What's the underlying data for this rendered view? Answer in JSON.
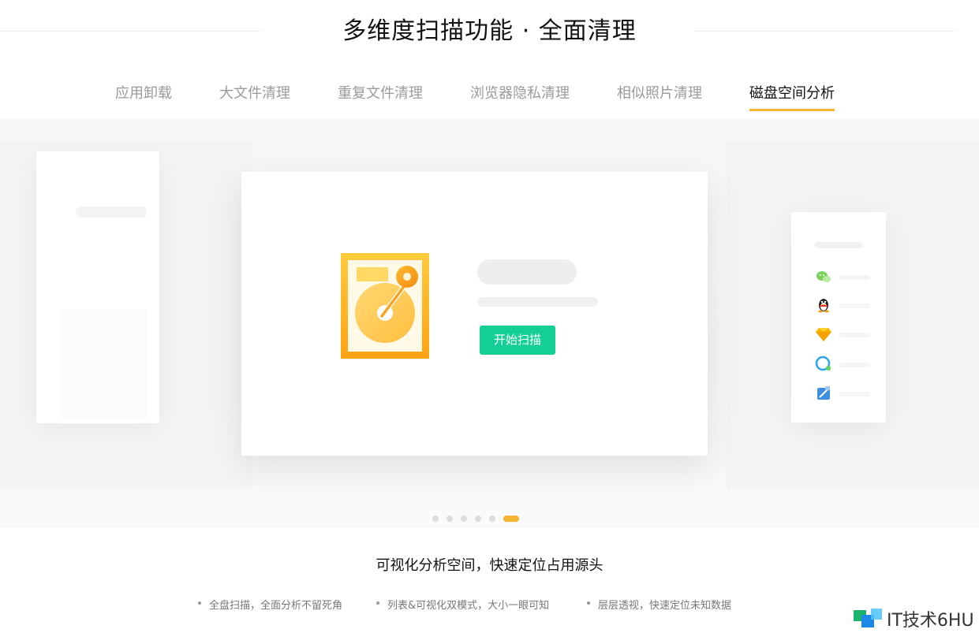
{
  "header": {
    "title": "多维度扫描功能 · 全面清理"
  },
  "tabs": [
    {
      "label": "应用卸载",
      "active": false
    },
    {
      "label": "大文件清理",
      "active": false
    },
    {
      "label": "重复文件清理",
      "active": false
    },
    {
      "label": "浏览器隐私清理",
      "active": false
    },
    {
      "label": "相似照片清理",
      "active": false
    },
    {
      "label": "磁盘空间分析",
      "active": true
    }
  ],
  "main_card": {
    "icon": "hard-disk-scan-icon",
    "scan_button_label": "开始扫描"
  },
  "side_card_right": {
    "app_icons": [
      "wechat-icon",
      "qq-penguin-icon",
      "sketch-diamond-icon",
      "chat-bubble-icon",
      "xcode-icon"
    ]
  },
  "pagination": {
    "count": 6,
    "active_index": 5
  },
  "caption": "可视化分析空间，快速定位占用源头",
  "features": [
    "全盘扫描，全面分析不留死角",
    "列表&可视化双模式，大小一眼可知",
    "层层透视，快速定位未知数据"
  ],
  "watermark": {
    "text": "IT技术6HU",
    "icon": "watermark-logo-icon"
  },
  "colors": {
    "accent": "#f5b731",
    "button": "#13cf95",
    "tab_inactive": "#9a9a9a",
    "tab_active": "#111111"
  }
}
